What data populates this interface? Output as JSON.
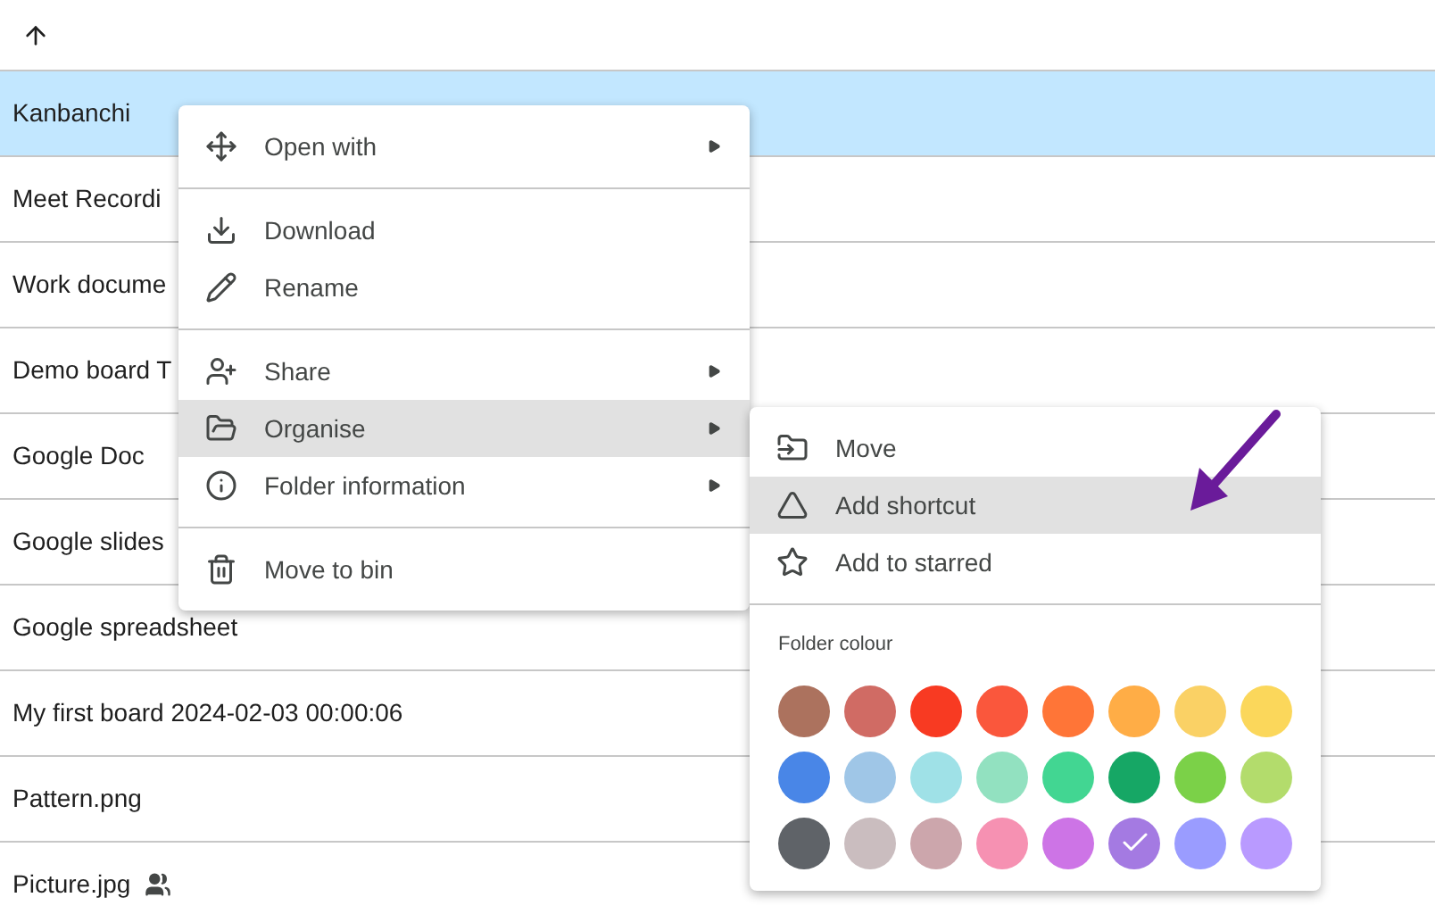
{
  "files": [
    {
      "name": "Kanbanchi",
      "selected": true,
      "shared": false
    },
    {
      "name": "Meet Recordi",
      "selected": false,
      "shared": false
    },
    {
      "name": "Work docume",
      "selected": false,
      "shared": false
    },
    {
      "name": "Demo board T",
      "selected": false,
      "shared": false
    },
    {
      "name": "Google Doc",
      "selected": false,
      "shared": false
    },
    {
      "name": "Google slides",
      "selected": false,
      "shared": false
    },
    {
      "name": "Google spreadsheet",
      "selected": false,
      "shared": false
    },
    {
      "name": "My first board 2024-02-03 00:00:06",
      "selected": false,
      "shared": false
    },
    {
      "name": "Pattern.png",
      "selected": false,
      "shared": false
    },
    {
      "name": "Picture.jpg",
      "selected": false,
      "shared": true
    }
  ],
  "context_menu": {
    "groups": [
      [
        {
          "label": "Open with",
          "submenu": true,
          "selected": false
        }
      ],
      [
        {
          "label": "Download",
          "submenu": false,
          "selected": false
        },
        {
          "label": "Rename",
          "submenu": false,
          "selected": false
        }
      ],
      [
        {
          "label": "Share",
          "submenu": true,
          "selected": false
        },
        {
          "label": "Organise",
          "submenu": true,
          "selected": true
        },
        {
          "label": "Folder information",
          "submenu": true,
          "selected": false
        }
      ],
      [
        {
          "label": "Move to bin",
          "submenu": false,
          "selected": false
        }
      ]
    ]
  },
  "submenu": {
    "items": [
      {
        "label": "Move",
        "selected": false
      },
      {
        "label": "Add shortcut",
        "selected": true
      },
      {
        "label": "Add to starred",
        "selected": false
      }
    ],
    "colour_label": "Folder colour",
    "colours": [
      {
        "color": "#ac725e",
        "selected": false
      },
      {
        "color": "#d06b64",
        "selected": false
      },
      {
        "color": "#f83a22",
        "selected": false
      },
      {
        "color": "#fa573c",
        "selected": false
      },
      {
        "color": "#ff7537",
        "selected": false
      },
      {
        "color": "#ffad46",
        "selected": false
      },
      {
        "color": "#fad165",
        "selected": false
      },
      {
        "color": "#fbd75b",
        "selected": false
      },
      {
        "color": "#4986e7",
        "selected": false
      },
      {
        "color": "#9fc6e7",
        "selected": false
      },
      {
        "color": "#9fe1e7",
        "selected": false
      },
      {
        "color": "#92e1c0",
        "selected": false
      },
      {
        "color": "#42d692",
        "selected": false
      },
      {
        "color": "#16a765",
        "selected": false
      },
      {
        "color": "#7bd148",
        "selected": false
      },
      {
        "color": "#b3dc6c",
        "selected": false
      },
      {
        "color": "#5f6368",
        "selected": false
      },
      {
        "color": "#cabdbf",
        "selected": false
      },
      {
        "color": "#cca6ac",
        "selected": false
      },
      {
        "color": "#f691b2",
        "selected": false
      },
      {
        "color": "#cd74e6",
        "selected": false
      },
      {
        "color": "#a47ae2",
        "selected": true
      },
      {
        "color": "#9a9cff",
        "selected": false
      },
      {
        "color": "#b99aff",
        "selected": false
      }
    ]
  }
}
